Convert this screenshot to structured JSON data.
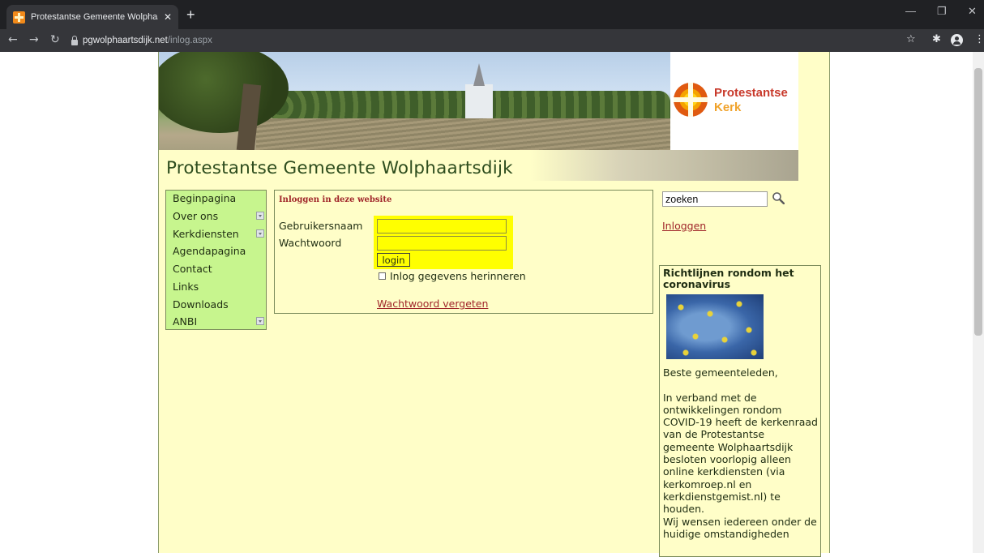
{
  "browser": {
    "tab_title": "Protestantse Gemeente Wolphaa",
    "new_tab": "+",
    "url_host": "pgwolphaartsdijk.net",
    "url_path": "/inlog.aspx"
  },
  "header": {
    "logo_line1": "Protestantse",
    "logo_line2": "Kerk",
    "site_title": "Protestantse Gemeente Wolphaartsdijk"
  },
  "menu": {
    "items": [
      {
        "label": "Beginpagina",
        "expandable": false
      },
      {
        "label": "Over ons",
        "expandable": true
      },
      {
        "label": "Kerkdiensten",
        "expandable": true
      },
      {
        "label": "Agendapagina",
        "expandable": false
      },
      {
        "label": "Contact",
        "expandable": false
      },
      {
        "label": "Links",
        "expandable": false
      },
      {
        "label": "Downloads",
        "expandable": false
      },
      {
        "label": "ANBI",
        "expandable": true
      }
    ]
  },
  "login": {
    "heading": "Inloggen in deze website",
    "username_label": "Gebruikersnaam",
    "username_value": "",
    "password_label": "Wachtwoord",
    "password_value": "",
    "button": "login",
    "remember": "Inlog gegevens herinneren",
    "forgot": "Wachtwoord vergeten"
  },
  "search": {
    "value": "zoeken"
  },
  "sidebar": {
    "login_link": "Inloggen",
    "news_title": "Richtlijnen rondom het coronavirus",
    "news_body": "Beste gemeenteleden,\n\nIn verband met de ontwikkelingen rondom COVID-19 heeft de kerkenraad van de Protestantse gemeente Wolphaartsdijk besloten voorlopig alleen online kerkdiensten (via kerkomroep.nl en kerkdienstgemist.nl) te houden.\nWij wensen iedereen onder de huidige omstandigheden"
  }
}
